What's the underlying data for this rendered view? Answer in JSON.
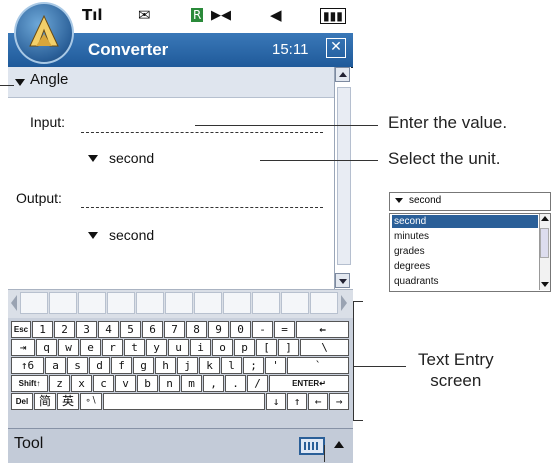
{
  "status_bar": {
    "icons": [
      "signal-icon",
      "mail-icon",
      "roaming-icon",
      "bluetooth-icon",
      "volume-icon",
      "battery-icon"
    ]
  },
  "title_bar": {
    "title": "Converter",
    "time": "15:11"
  },
  "converter": {
    "category": "Angle",
    "input_label": "Input:",
    "input_value": "",
    "input_unit": "second",
    "output_label": "Output:",
    "output_value": "",
    "output_unit": "second"
  },
  "keyboard": {
    "rows": [
      [
        "Esc",
        "1",
        "2",
        "3",
        "4",
        "5",
        "6",
        "7",
        "8",
        "9",
        "0",
        "-",
        "=",
        "←"
      ],
      [
        "⇥",
        "q",
        "w",
        "e",
        "r",
        "t",
        "y",
        "u",
        "i",
        "o",
        "p",
        "[",
        "]",
        "\\"
      ],
      [
        "↑6",
        "a",
        "s",
        "d",
        "f",
        "g",
        "h",
        "j",
        "k",
        "l",
        ";",
        "'",
        "`"
      ],
      [
        "Shift↑",
        "z",
        "x",
        "c",
        "v",
        "b",
        "n",
        "m",
        ",",
        ".",
        "/",
        "ENTER↵"
      ],
      [
        "Del",
        "简",
        "英",
        "∘∖",
        "",
        "↓",
        "↑",
        "←",
        "→"
      ]
    ]
  },
  "bottom_bar": {
    "tool_label": "Tool"
  },
  "callouts": {
    "enter_value": "Enter the value.",
    "select_unit": "Select the unit.",
    "text_entry": "Text Entry\nscreen"
  },
  "unit_dropdown": {
    "selected": "second",
    "options": [
      "second",
      "minutes",
      "grades",
      "degrees",
      "quadrants"
    ]
  },
  "colors": {
    "title_blue": "#1f5a9a",
    "selected_row": "#2a5f98"
  }
}
